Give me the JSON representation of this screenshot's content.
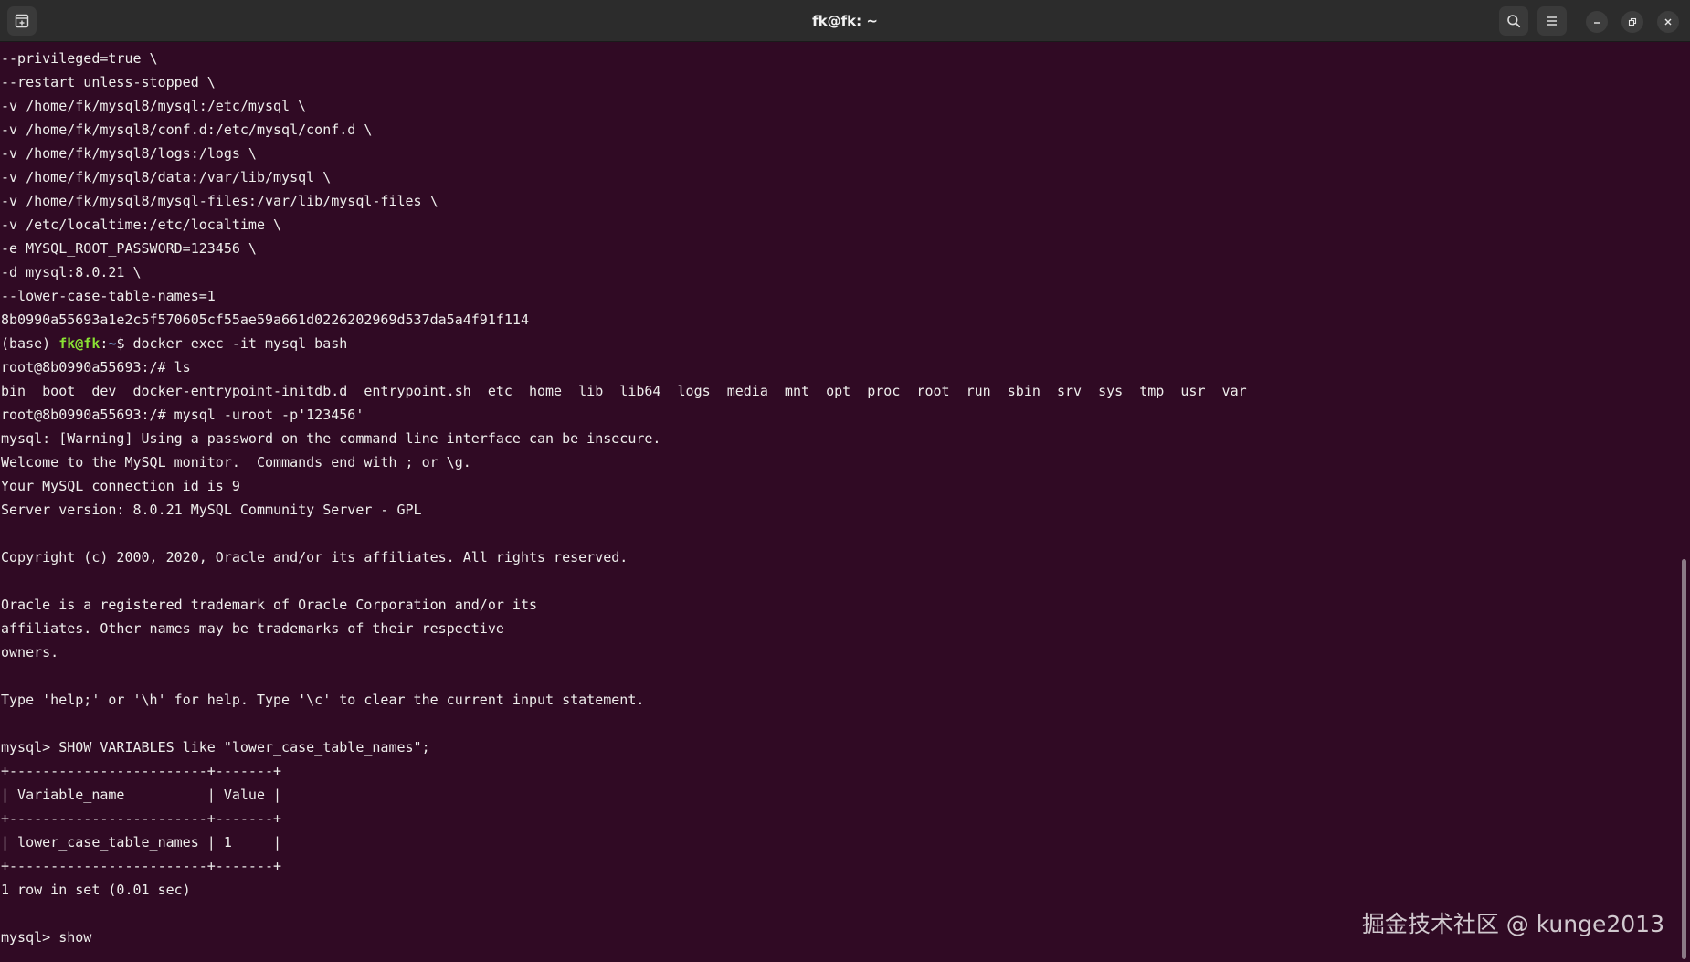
{
  "window": {
    "title": "fk@fk: ~"
  },
  "icons": {
    "new_tab": "new-tab-icon",
    "search": "search-icon",
    "menu": "hamburger-menu-icon",
    "minimize": "minimize-icon",
    "maximize": "maximize-icon",
    "close": "close-icon"
  },
  "colors": {
    "terminal_bg": "#300a24",
    "titlebar_bg": "#2c2c2c",
    "text": "#eeeeec",
    "prompt_user": "#8ae234",
    "prompt_path": "#729fcf"
  },
  "terminal": {
    "lines": [
      "--privileged=true \\",
      "--restart unless-stopped \\",
      "-v /home/fk/mysql8/mysql:/etc/mysql \\",
      "-v /home/fk/mysql8/conf.d:/etc/mysql/conf.d \\",
      "-v /home/fk/mysql8/logs:/logs \\",
      "-v /home/fk/mysql8/data:/var/lib/mysql \\",
      "-v /home/fk/mysql8/mysql-files:/var/lib/mysql-files \\",
      "-v /etc/localtime:/etc/localtime \\",
      "-e MYSQL_ROOT_PASSWORD=123456 \\",
      "-d mysql:8.0.21 \\",
      "--lower-case-table-names=1",
      "8b0990a55693a1e2c5f570605cf55ae59a661d0226202969d537da5a4f91f114"
    ],
    "prompt": {
      "env": "(base) ",
      "user_host": "fk@fk",
      "colon": ":",
      "path": "~",
      "dollar": "$ ",
      "command": "docker exec -it mysql bash"
    },
    "lines_after": [
      "root@8b0990a55693:/# ls",
      "bin  boot  dev  docker-entrypoint-initdb.d  entrypoint.sh  etc  home  lib  lib64  logs  media  mnt  opt  proc  root  run  sbin  srv  sys  tmp  usr  var",
      "root@8b0990a55693:/# mysql -uroot -p'123456'",
      "mysql: [Warning] Using a password on the command line interface can be insecure.",
      "Welcome to the MySQL monitor.  Commands end with ; or \\g.",
      "Your MySQL connection id is 9",
      "Server version: 8.0.21 MySQL Community Server - GPL",
      "",
      "Copyright (c) 2000, 2020, Oracle and/or its affiliates. All rights reserved.",
      "",
      "Oracle is a registered trademark of Oracle Corporation and/or its",
      "affiliates. Other names may be trademarks of their respective",
      "owners.",
      "",
      "Type 'help;' or '\\h' for help. Type '\\c' to clear the current input statement.",
      "",
      "mysql> SHOW VARIABLES like \"lower_case_table_names\";",
      "+------------------------+-------+",
      "| Variable_name          | Value |",
      "+------------------------+-------+",
      "| lower_case_table_names | 1     |",
      "+------------------------+-------+",
      "1 row in set (0.01 sec)",
      "",
      "mysql> show"
    ]
  },
  "scrollbar": {
    "position_fraction": 0.94,
    "visible_fraction": 0.44
  },
  "watermark": "掘金技术社区 @ kunge2013"
}
